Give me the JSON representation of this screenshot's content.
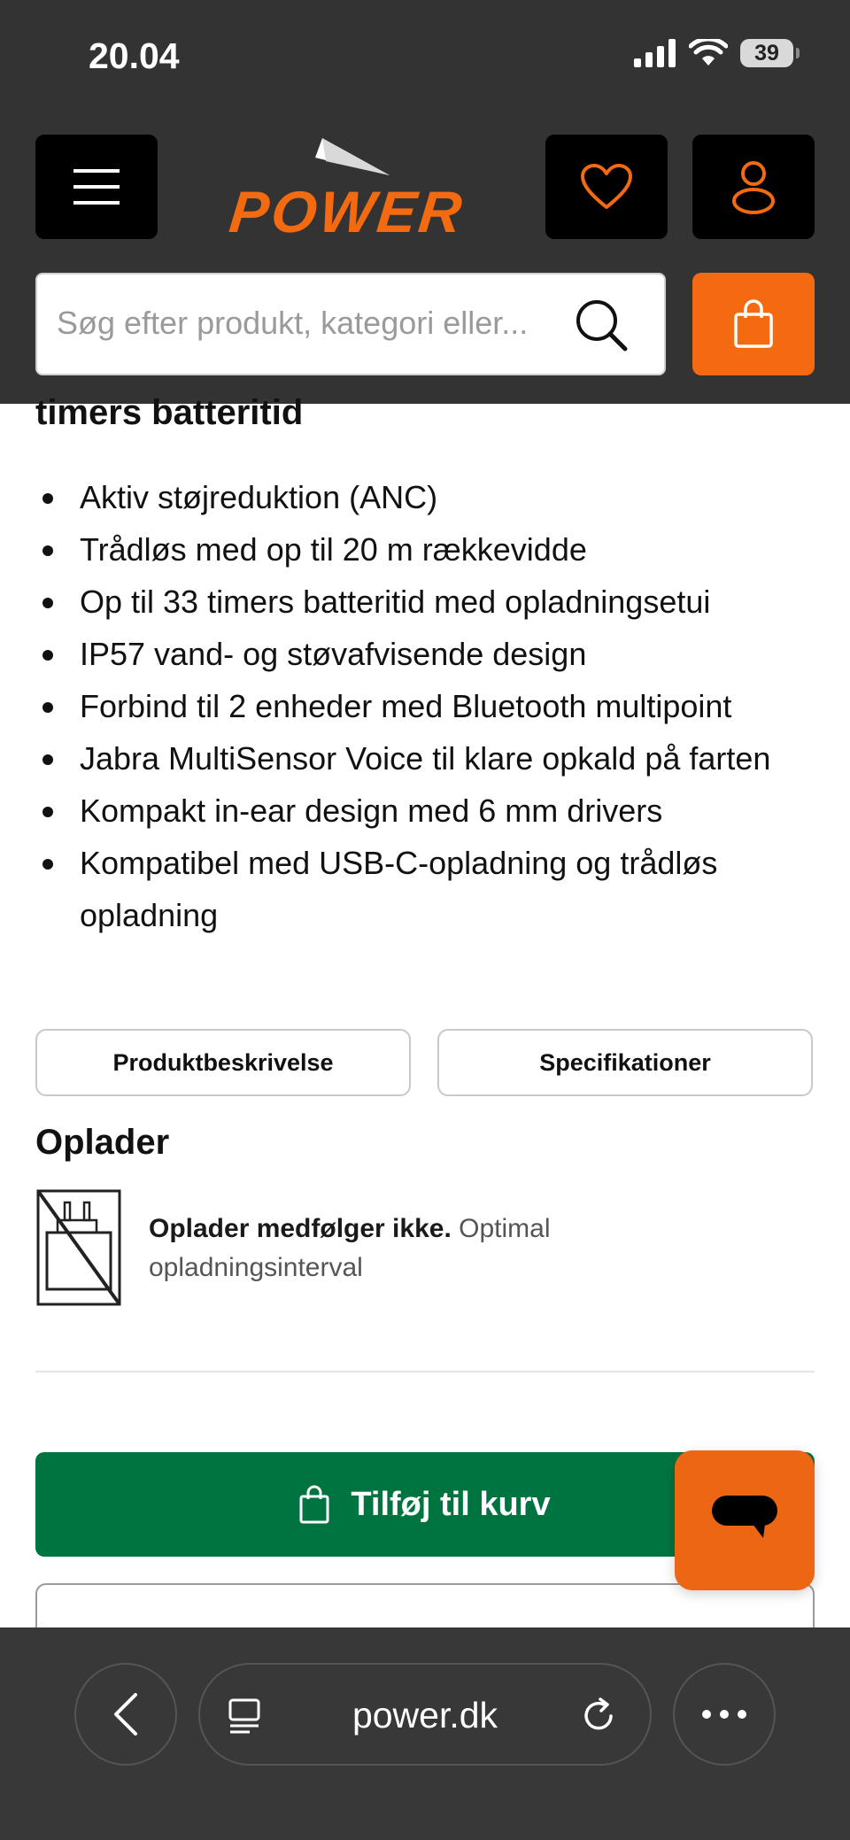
{
  "status_bar": {
    "time": "20.04",
    "battery": "39"
  },
  "header": {
    "brand": "POWER",
    "search_placeholder": "Søg efter produkt, kategori eller...",
    "accent_color": "#f36a10"
  },
  "product": {
    "heading_continued": "timers batteritid",
    "features": [
      "Aktiv støjreduktion (ANC)",
      "Trådløs med op til 20 m rækkevidde",
      "Op til 33 timers batteritid med opladningsetui",
      "IP57 vand- og støvafvisende design",
      "Forbind til 2 enheder med Bluetooth multipoint",
      "Jabra MultiSensor Voice til klare opkald på farten",
      "Kompakt in-ear design med 6 mm drivers",
      "Kompatibel med USB-C-opladning og trådløs opladning"
    ],
    "tabs": {
      "description": "Produktbeskrivelse",
      "specifications": "Specifikationer"
    },
    "charger": {
      "title": "Oplader",
      "bold_text": "Oplader medfølger ikke.",
      "text": "Optimal opladningsinterval"
    },
    "add_to_cart": "Tilføj til kurv",
    "add_to_cart_color": "#007440"
  },
  "browser": {
    "url": "power.dk"
  }
}
